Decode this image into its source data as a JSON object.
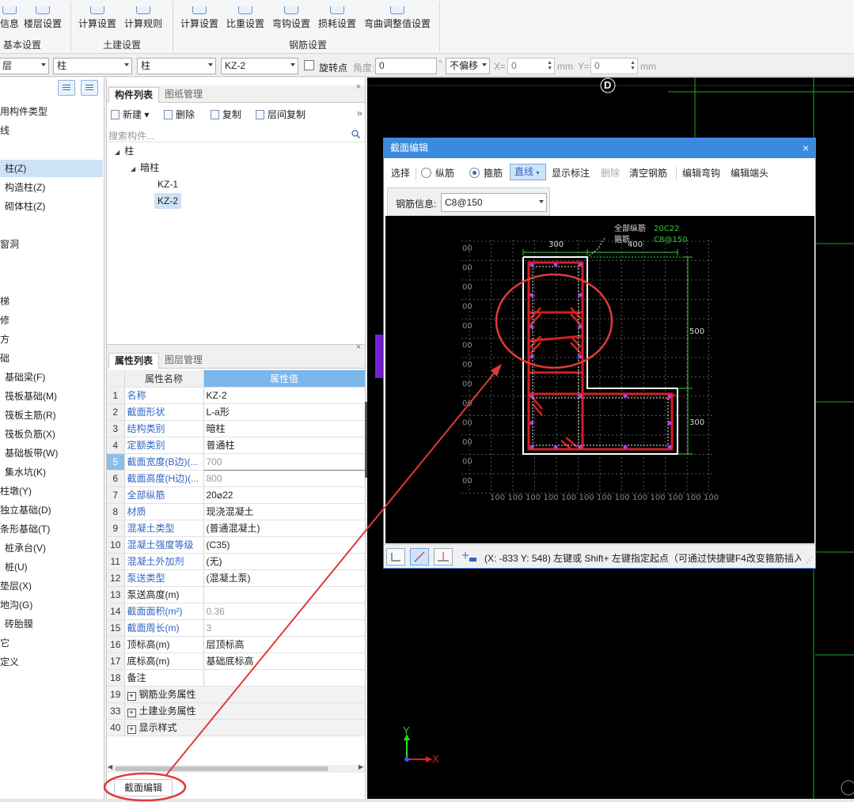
{
  "ribbon": {
    "buttons": [
      "信息",
      "楼层设置",
      "计算设置",
      "计算规则",
      "计算设置",
      "比重设置",
      "弯钩设置",
      "损耗设置",
      "弯曲调整值设置"
    ],
    "groups": [
      "基本设置",
      "土建设置",
      "钢筋设置"
    ]
  },
  "toolbar": {
    "combo1": "层",
    "combo2": "柱",
    "combo3": "柱",
    "combo4": "KZ-2",
    "rotate_label": "旋转点",
    "angle_label": "角度:",
    "angle_value": "0",
    "degree": "°",
    "offset_value": "不偏移",
    "x_label": "X=",
    "x_value": "0",
    "unit1": "mm",
    "y_label": "Y=",
    "y_value": "0",
    "unit2": "mm"
  },
  "left_tree": {
    "items": [
      "用构件类型",
      "线",
      "柱(Z)",
      "构造柱(Z)",
      "砌体柱(Z)",
      "窗洞",
      "梯",
      "修",
      "方",
      "础",
      "基础梁(F)",
      "筏板基础(M)",
      "筏板主筋(R)",
      "筏板负筋(X)",
      "基础板带(W)",
      "集水坑(K)",
      "柱墩(Y)",
      "独立基础(D)",
      "条形基础(T)",
      "桩承台(V)",
      "桩(U)",
      "垫层(X)",
      "地沟(G)",
      "砖胎膜",
      "它",
      "定义"
    ]
  },
  "component_list": {
    "tabs": [
      "构件列表",
      "图纸管理"
    ],
    "toolbar": [
      "新建",
      "删除",
      "复制",
      "层间复制"
    ],
    "search_placeholder": "搜索构件...",
    "tree": {
      "root": "柱",
      "child": "暗柱",
      "items": [
        "KZ-1",
        "KZ-2"
      ]
    }
  },
  "property_list": {
    "tabs": [
      "属性列表",
      "图层管理"
    ],
    "header_name": "属性名称",
    "header_value": "属性值",
    "rows": [
      {
        "num": "1",
        "name": "名称",
        "value": "KZ-2"
      },
      {
        "num": "2",
        "name": "截面形状",
        "value": "L-a形"
      },
      {
        "num": "3",
        "name": "结构类别",
        "value": "暗柱"
      },
      {
        "num": "4",
        "name": "定额类别",
        "value": "普通柱"
      },
      {
        "num": "5",
        "name": "截面宽度(B边)(...",
        "value": "700"
      },
      {
        "num": "6",
        "name": "截面高度(H边)(...",
        "value": "800"
      },
      {
        "num": "7",
        "name": "全部纵筋",
        "value": "20⌀22"
      },
      {
        "num": "8",
        "name": "材质",
        "value": "现浇混凝土"
      },
      {
        "num": "9",
        "name": "混凝土类型",
        "value": "(普通混凝土)"
      },
      {
        "num": "10",
        "name": "混凝土强度等级",
        "value": "(C35)"
      },
      {
        "num": "11",
        "name": "混凝土外加剂",
        "value": "(无)"
      },
      {
        "num": "12",
        "name": "泵送类型",
        "value": "(混凝土泵)"
      },
      {
        "num": "13",
        "name": "泵送高度(m)",
        "value": ""
      },
      {
        "num": "14",
        "name": "截面面积(m²)",
        "value": "0.36"
      },
      {
        "num": "15",
        "name": "截面周长(m)",
        "value": "3"
      },
      {
        "num": "16",
        "name": "顶标高(m)",
        "value": "层顶标高"
      },
      {
        "num": "17",
        "name": "底标高(m)",
        "value": "基础底标高"
      },
      {
        "num": "18",
        "name": "备注",
        "value": ""
      },
      {
        "num": "19",
        "name": "钢筋业务属性",
        "value": ""
      },
      {
        "num": "33",
        "name": "土建业务属性",
        "value": ""
      },
      {
        "num": "40",
        "name": "显示样式",
        "value": ""
      }
    ]
  },
  "bottom_tab": "截面编辑",
  "dialog": {
    "title": "截面编辑",
    "close": "×",
    "toolbar": {
      "select": "选择",
      "longitudinal": "纵筋",
      "stirrup": "箍筋",
      "line": "直线",
      "show_dim": "显示标注",
      "delete": "删除",
      "clear": "清空钢筋",
      "edit_hook": "编辑弯钩",
      "edit_end": "编辑端头"
    },
    "rebar_info_label": "钢筋信息:",
    "rebar_info_value": "C8@150",
    "drawing": {
      "label_all": "全部纵筋",
      "label_all_value": "20C22",
      "label_stirrup": "箍筋",
      "label_stirrup_value": "C8@150",
      "dim_300_top": "300",
      "dim_400": "400",
      "dim_500": "500",
      "dim_300_right": "300",
      "left_labels": [
        "00",
        "00",
        "00",
        "00",
        "00",
        "00",
        "00",
        "00",
        "00",
        "00",
        "00",
        "00",
        "00"
      ],
      "bottom_labels": [
        "100",
        "100",
        "100",
        "100",
        "100",
        "100",
        "100",
        "100",
        "100",
        "100",
        "100",
        "100",
        "100"
      ]
    },
    "status": "(X: -833 Y: 548)  左键或 Shift+ 左键指定起点（可通过快捷键F4改变箍筋插入点）"
  },
  "canvas": {
    "axis_label": "D",
    "x_axis": "X",
    "y_axis": "Y"
  },
  "colors": {
    "annotation_red": "#e03a3a",
    "rebar_red": "#d42020",
    "dim_green": "#33cc33",
    "accent_blue": "#3c8ae0"
  }
}
